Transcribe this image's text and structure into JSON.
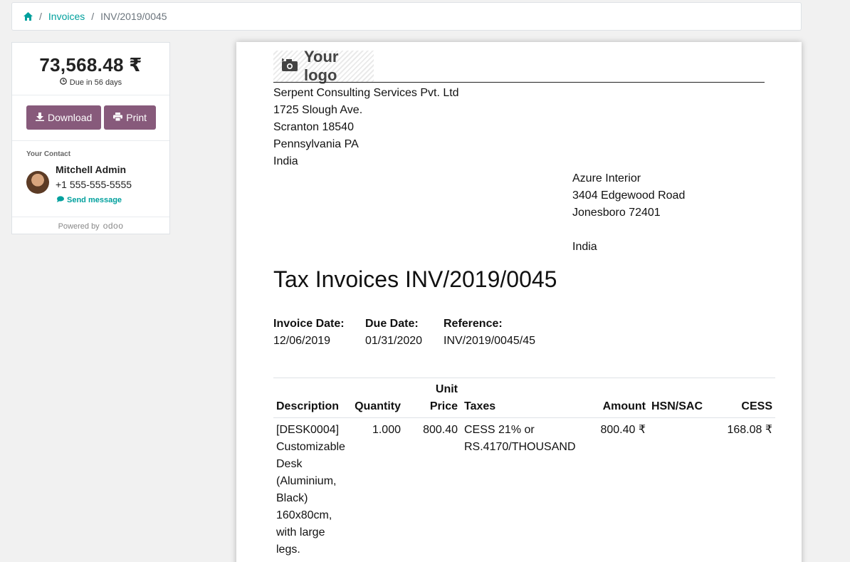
{
  "breadcrumb": {
    "home_icon": "home-icon",
    "items": [
      "Invoices",
      "INV/2019/0045"
    ]
  },
  "sidebar": {
    "amount": "73,568.48 ₹",
    "due_icon": "clock-icon",
    "due_text": "Due in 56 days",
    "download_label": "Download",
    "print_label": "Print",
    "contact_label": "Your Contact",
    "contact_name": "Mitchell Admin",
    "contact_phone": "+1 555-555-5555",
    "send_message_label": "Send message",
    "powered_by_label": "Powered by",
    "powered_by_brand": "odoo"
  },
  "invoice": {
    "logo_text": "Your logo",
    "company_lines": [
      "Serpent Consulting Services Pvt. Ltd",
      "1725 Slough Ave.",
      "Scranton 18540",
      "Pennsylvania PA",
      "India"
    ],
    "customer_lines": [
      "Azure Interior",
      "3404 Edgewood Road",
      "Jonesboro 72401",
      "",
      "India"
    ],
    "title": "Tax Invoices INV/2019/0045",
    "invoice_date_label": "Invoice Date:",
    "invoice_date": "12/06/2019",
    "due_date_label": "Due Date:",
    "due_date": "01/31/2020",
    "reference_label": "Reference:",
    "reference": "INV/2019/0045/45",
    "table": {
      "headers": {
        "description": "Description",
        "quantity": "Quantity",
        "unit_price_1": "Unit",
        "unit_price_2": "Price",
        "taxes": "Taxes",
        "amount": "Amount",
        "hsn": "HSN/SAC",
        "cess": "CESS"
      },
      "rows": [
        {
          "description_lines": [
            "[DESK0004]",
            "Customizable",
            "Desk",
            "(Aluminium,",
            "Black)",
            "160x80cm,",
            "with large",
            "legs."
          ],
          "quantity": "1.000",
          "unit_price": "800.40",
          "taxes_lines": [
            "CESS 21% or",
            "RS.4170/THOUSAND"
          ],
          "amount": "800.40 ₹",
          "hsn": "",
          "cess": "168.08 ₹"
        }
      ]
    }
  }
}
